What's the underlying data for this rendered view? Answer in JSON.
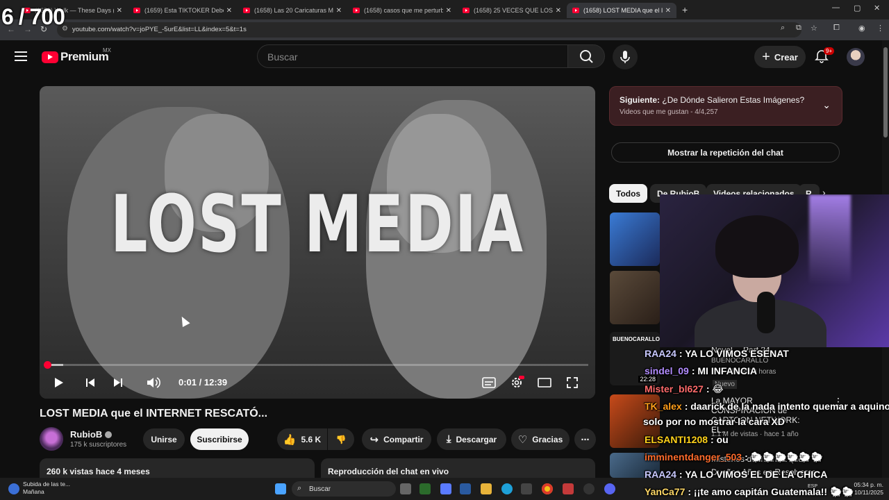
{
  "overlay_counter": "6 / 700",
  "browser": {
    "tabs": [
      {
        "title": "(1659) Walk — These Days (C"
      },
      {
        "title": "(1659) Esta TIKTOKER Debe Est"
      },
      {
        "title": "(1658) Las 20 Caricaturas Más C"
      },
      {
        "title": "(1658) casos que me perturban"
      },
      {
        "title": "(1658) 25 VECES QUE LOS GRIN"
      },
      {
        "title": "(1658) LOST MEDIA que el INTE"
      }
    ],
    "url": "youtube.com/watch?v=joPYE_-5urE&list=LL&index=5&t=1s"
  },
  "yt": {
    "logo_text": "Premium",
    "country": "MX",
    "search_placeholder": "Buscar",
    "create_label": "Crear",
    "notifications": "9+"
  },
  "player": {
    "overlay_title": "LOST MEDIA",
    "time": "0:01 / 12:39",
    "progress": 0.0013
  },
  "video": {
    "title": "LOST MEDIA que el INTERNET RESCATÓ...",
    "channel": "RubioB",
    "subscribers": "175 k suscriptores",
    "join_label": "Unirse",
    "subscribe_label": "Suscribirse",
    "likes": "5.6 K",
    "share_label": "Compartir",
    "download_label": "Descargar",
    "thanks_label": "Gracias",
    "views": "260 k vistas  hace 4 meses",
    "chat_replay_box": "Reproducción del chat en vivo"
  },
  "sidebar": {
    "upnext_prefix": "Siguiente:",
    "upnext_title": "¿De Dónde Salieron Estas Imágenes?",
    "upnext_meta": "Videos que me gustan - 4/4,257",
    "chat_replay_label": "Mostrar la repetición del chat",
    "chips": [
      "Todos",
      "De RubioB",
      "Videos relacionados",
      "R"
    ],
    "related": [
      {
        "title": "Novel… Part 24",
        "channel": "BUENOCARALLO",
        "meta": "hace 10 horas",
        "duration": "22:28",
        "badge": "Nuevo",
        "thumb_text": "BUENOCARALLO"
      },
      {
        "title": "La MAYOR CONSPIRACION de CARTOON NETWORK: EL...",
        "meta": "1.1 M de vistas · hace 1 año"
      },
      {
        "title": "Misterios de Internet que",
        "title2": "Dueños Años en Resolverse"
      }
    ]
  },
  "chat": [
    {
      "user": "RAA24",
      "text": ": YA LO VIMOS ESENAT",
      "color": "#c9c9ff"
    },
    {
      "user": "sindel_09",
      "text": ": MI INFANCIA",
      "color": "#b28cff"
    },
    {
      "user": "Mister_bl627",
      "text": ": 😂",
      "color": "#ff6b6b"
    },
    {
      "user": "TK_alex",
      "text": ": daarick de la nada intento quemar a aquino",
      "color": "#ff9f1a"
    },
    {
      "text": "solo por no mostrar la cara XD"
    },
    {
      "user": "ELSANTI1208",
      "text": ": ou",
      "color": "#ffd21a"
    },
    {
      "user": "imminentdanger_503",
      "text": ": 🐑🐑🐑🐑🐑🐑",
      "color": "#ff6b2b"
    },
    {
      "user": "RAA24",
      "text": ": YA LO VIMOS EL DE LA CHICA",
      "color": "#c9c9ff"
    },
    {
      "user": "YanCa77",
      "text": ": ¡¡te amo capitán Guatemala!! 🐑🐑",
      "color": "#ffd866"
    }
  ],
  "taskbar": {
    "weather_line1": "Subida de las te...",
    "weather_line2": "Mañana",
    "search_label": "Buscar",
    "lang": "ESP",
    "time": "05:34 p. m.",
    "date": "10/11/2025"
  },
  "colors": {
    "accent_red": "#ff0033",
    "upnext_bg": "#3b1f22"
  }
}
